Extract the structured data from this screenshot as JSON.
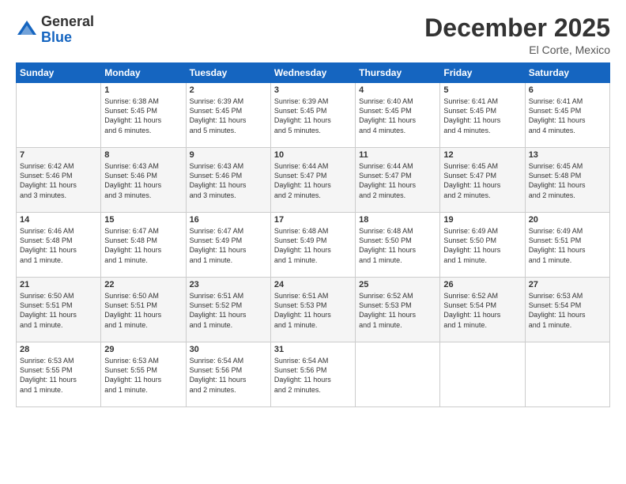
{
  "logo": {
    "general": "General",
    "blue": "Blue"
  },
  "title": "December 2025",
  "location": "El Corte, Mexico",
  "days_header": [
    "Sunday",
    "Monday",
    "Tuesday",
    "Wednesday",
    "Thursday",
    "Friday",
    "Saturday"
  ],
  "weeks": [
    [
      {
        "num": "",
        "info": ""
      },
      {
        "num": "1",
        "info": "Sunrise: 6:38 AM\nSunset: 5:45 PM\nDaylight: 11 hours\nand 6 minutes."
      },
      {
        "num": "2",
        "info": "Sunrise: 6:39 AM\nSunset: 5:45 PM\nDaylight: 11 hours\nand 5 minutes."
      },
      {
        "num": "3",
        "info": "Sunrise: 6:39 AM\nSunset: 5:45 PM\nDaylight: 11 hours\nand 5 minutes."
      },
      {
        "num": "4",
        "info": "Sunrise: 6:40 AM\nSunset: 5:45 PM\nDaylight: 11 hours\nand 4 minutes."
      },
      {
        "num": "5",
        "info": "Sunrise: 6:41 AM\nSunset: 5:45 PM\nDaylight: 11 hours\nand 4 minutes."
      },
      {
        "num": "6",
        "info": "Sunrise: 6:41 AM\nSunset: 5:45 PM\nDaylight: 11 hours\nand 4 minutes."
      }
    ],
    [
      {
        "num": "7",
        "info": "Sunrise: 6:42 AM\nSunset: 5:46 PM\nDaylight: 11 hours\nand 3 minutes."
      },
      {
        "num": "8",
        "info": "Sunrise: 6:43 AM\nSunset: 5:46 PM\nDaylight: 11 hours\nand 3 minutes."
      },
      {
        "num": "9",
        "info": "Sunrise: 6:43 AM\nSunset: 5:46 PM\nDaylight: 11 hours\nand 3 minutes."
      },
      {
        "num": "10",
        "info": "Sunrise: 6:44 AM\nSunset: 5:47 PM\nDaylight: 11 hours\nand 2 minutes."
      },
      {
        "num": "11",
        "info": "Sunrise: 6:44 AM\nSunset: 5:47 PM\nDaylight: 11 hours\nand 2 minutes."
      },
      {
        "num": "12",
        "info": "Sunrise: 6:45 AM\nSunset: 5:47 PM\nDaylight: 11 hours\nand 2 minutes."
      },
      {
        "num": "13",
        "info": "Sunrise: 6:45 AM\nSunset: 5:48 PM\nDaylight: 11 hours\nand 2 minutes."
      }
    ],
    [
      {
        "num": "14",
        "info": "Sunrise: 6:46 AM\nSunset: 5:48 PM\nDaylight: 11 hours\nand 1 minute."
      },
      {
        "num": "15",
        "info": "Sunrise: 6:47 AM\nSunset: 5:48 PM\nDaylight: 11 hours\nand 1 minute."
      },
      {
        "num": "16",
        "info": "Sunrise: 6:47 AM\nSunset: 5:49 PM\nDaylight: 11 hours\nand 1 minute."
      },
      {
        "num": "17",
        "info": "Sunrise: 6:48 AM\nSunset: 5:49 PM\nDaylight: 11 hours\nand 1 minute."
      },
      {
        "num": "18",
        "info": "Sunrise: 6:48 AM\nSunset: 5:50 PM\nDaylight: 11 hours\nand 1 minute."
      },
      {
        "num": "19",
        "info": "Sunrise: 6:49 AM\nSunset: 5:50 PM\nDaylight: 11 hours\nand 1 minute."
      },
      {
        "num": "20",
        "info": "Sunrise: 6:49 AM\nSunset: 5:51 PM\nDaylight: 11 hours\nand 1 minute."
      }
    ],
    [
      {
        "num": "21",
        "info": "Sunrise: 6:50 AM\nSunset: 5:51 PM\nDaylight: 11 hours\nand 1 minute."
      },
      {
        "num": "22",
        "info": "Sunrise: 6:50 AM\nSunset: 5:51 PM\nDaylight: 11 hours\nand 1 minute."
      },
      {
        "num": "23",
        "info": "Sunrise: 6:51 AM\nSunset: 5:52 PM\nDaylight: 11 hours\nand 1 minute."
      },
      {
        "num": "24",
        "info": "Sunrise: 6:51 AM\nSunset: 5:53 PM\nDaylight: 11 hours\nand 1 minute."
      },
      {
        "num": "25",
        "info": "Sunrise: 6:52 AM\nSunset: 5:53 PM\nDaylight: 11 hours\nand 1 minute."
      },
      {
        "num": "26",
        "info": "Sunrise: 6:52 AM\nSunset: 5:54 PM\nDaylight: 11 hours\nand 1 minute."
      },
      {
        "num": "27",
        "info": "Sunrise: 6:53 AM\nSunset: 5:54 PM\nDaylight: 11 hours\nand 1 minute."
      }
    ],
    [
      {
        "num": "28",
        "info": "Sunrise: 6:53 AM\nSunset: 5:55 PM\nDaylight: 11 hours\nand 1 minute."
      },
      {
        "num": "29",
        "info": "Sunrise: 6:53 AM\nSunset: 5:55 PM\nDaylight: 11 hours\nand 1 minute."
      },
      {
        "num": "30",
        "info": "Sunrise: 6:54 AM\nSunset: 5:56 PM\nDaylight: 11 hours\nand 2 minutes."
      },
      {
        "num": "31",
        "info": "Sunrise: 6:54 AM\nSunset: 5:56 PM\nDaylight: 11 hours\nand 2 minutes."
      },
      {
        "num": "",
        "info": ""
      },
      {
        "num": "",
        "info": ""
      },
      {
        "num": "",
        "info": ""
      }
    ]
  ]
}
